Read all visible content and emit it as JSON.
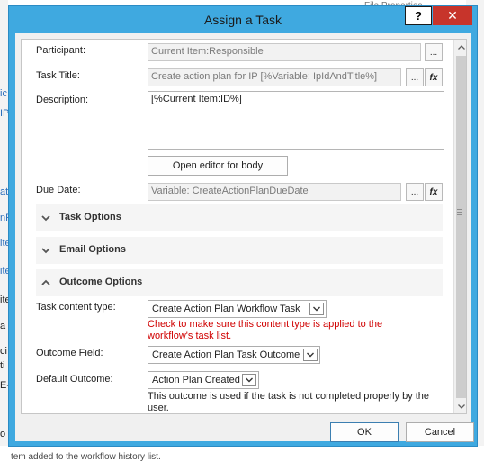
{
  "dialog": {
    "title": "Assign a Task",
    "help_label": "?",
    "close_label": "✕"
  },
  "background": {
    "top_title": "File Properties",
    "fragments": [
      "ic",
      "IP",
      "ate",
      "nR",
      "ite",
      "ite",
      "ite",
      "a",
      "ci",
      "ti",
      "E-",
      "o"
    ],
    "bottom_text": "tem added to the workflow history list.",
    "right_fragment": "e"
  },
  "form": {
    "participant": {
      "label": "Participant:",
      "value": "Current Item:Responsible",
      "browse": "..."
    },
    "task_title": {
      "label": "Task Title:",
      "value": "Create action plan for IP [%Variable: IpIdAndTitle%]",
      "browse": "...",
      "fx": "fx"
    },
    "description": {
      "label": "Description:",
      "value": "[%Current Item:ID%]"
    },
    "editor_button": "Open editor for body",
    "due_date": {
      "label": "Due Date:",
      "value": "Variable: CreateActionPlanDueDate",
      "browse": "...",
      "fx": "fx"
    },
    "sections": {
      "task_options": "Task Options",
      "email_options": "Email Options",
      "outcome_options": "Outcome Options"
    },
    "task_content_type": {
      "label": "Task content type:",
      "value": "Create Action Plan Workflow Task",
      "warning": "Check to make sure this content type is applied to the workflow's task list."
    },
    "outcome_field": {
      "label": "Outcome Field:",
      "value": "Create Action Plan Task Outcome"
    },
    "default_outcome": {
      "label": "Default Outcome:",
      "value": "Action Plan Created",
      "note": "This outcome is used if the task is not completed properly by the user."
    }
  },
  "footer": {
    "ok": "OK",
    "cancel": "Cancel"
  },
  "colors": {
    "titlebar": "#3fa9e0",
    "close": "#c7342b",
    "warning": "#d00000"
  }
}
